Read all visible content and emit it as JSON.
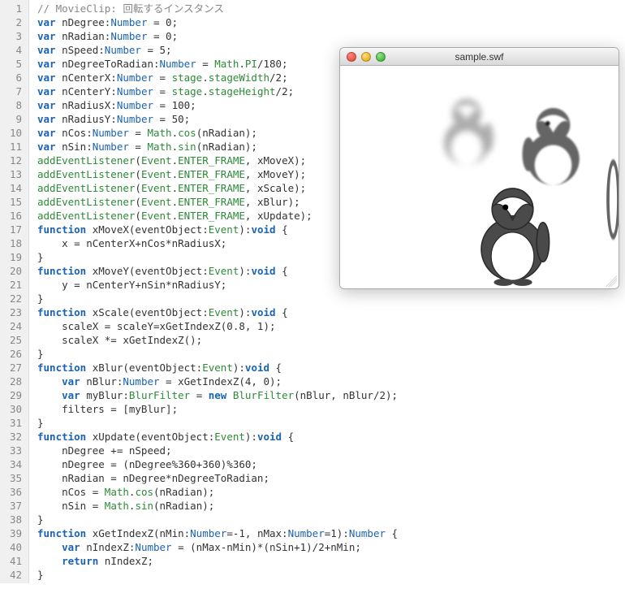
{
  "swf": {
    "title": "sample.swf"
  },
  "code": {
    "lines": [
      {
        "n": 1,
        "tokens": [
          [
            "cmt",
            "// MovieClip: 回転するインスタンス"
          ]
        ]
      },
      {
        "n": 2,
        "tokens": [
          [
            "kw",
            "var"
          ],
          [
            "txt",
            " nDegree:"
          ],
          [
            "type",
            "Number"
          ],
          [
            "txt",
            " = 0;"
          ]
        ]
      },
      {
        "n": 3,
        "tokens": [
          [
            "kw",
            "var"
          ],
          [
            "txt",
            " nRadian:"
          ],
          [
            "type",
            "Number"
          ],
          [
            "txt",
            " = 0;"
          ]
        ]
      },
      {
        "n": 4,
        "tokens": [
          [
            "kw",
            "var"
          ],
          [
            "txt",
            " nSpeed:"
          ],
          [
            "type",
            "Number"
          ],
          [
            "txt",
            " = 5;"
          ]
        ]
      },
      {
        "n": 5,
        "tokens": [
          [
            "kw",
            "var"
          ],
          [
            "txt",
            " nDegreeToRadian:"
          ],
          [
            "type",
            "Number"
          ],
          [
            "txt",
            " = "
          ],
          [
            "cls",
            "Math"
          ],
          [
            "txt",
            "."
          ],
          [
            "prop",
            "PI"
          ],
          [
            "txt",
            "/180;"
          ]
        ]
      },
      {
        "n": 6,
        "tokens": [
          [
            "kw",
            "var"
          ],
          [
            "txt",
            " nCenterX:"
          ],
          [
            "type",
            "Number"
          ],
          [
            "txt",
            " = "
          ],
          [
            "cls",
            "stage"
          ],
          [
            "txt",
            "."
          ],
          [
            "prop",
            "stageWidth"
          ],
          [
            "txt",
            "/2;"
          ]
        ]
      },
      {
        "n": 7,
        "tokens": [
          [
            "kw",
            "var"
          ],
          [
            "txt",
            " nCenterY:"
          ],
          [
            "type",
            "Number"
          ],
          [
            "txt",
            " = "
          ],
          [
            "cls",
            "stage"
          ],
          [
            "txt",
            "."
          ],
          [
            "prop",
            "stageHeight"
          ],
          [
            "txt",
            "/2;"
          ]
        ]
      },
      {
        "n": 8,
        "tokens": [
          [
            "kw",
            "var"
          ],
          [
            "txt",
            " nRadiusX:"
          ],
          [
            "type",
            "Number"
          ],
          [
            "txt",
            " = 100;"
          ]
        ]
      },
      {
        "n": 9,
        "tokens": [
          [
            "kw",
            "var"
          ],
          [
            "txt",
            " nRadiusY:"
          ],
          [
            "type",
            "Number"
          ],
          [
            "txt",
            " = 50;"
          ]
        ]
      },
      {
        "n": 10,
        "tokens": [
          [
            "kw",
            "var"
          ],
          [
            "txt",
            " nCos:"
          ],
          [
            "type",
            "Number"
          ],
          [
            "txt",
            " = "
          ],
          [
            "cls",
            "Math"
          ],
          [
            "txt",
            "."
          ],
          [
            "prop",
            "cos"
          ],
          [
            "txt",
            "(nRadian);"
          ]
        ]
      },
      {
        "n": 11,
        "tokens": [
          [
            "kw",
            "var"
          ],
          [
            "txt",
            " nSin:"
          ],
          [
            "type",
            "Number"
          ],
          [
            "txt",
            " = "
          ],
          [
            "cls",
            "Math"
          ],
          [
            "txt",
            "."
          ],
          [
            "prop",
            "sin"
          ],
          [
            "txt",
            "(nRadian);"
          ]
        ]
      },
      {
        "n": 12,
        "tokens": [
          [
            "call",
            "addEventListener"
          ],
          [
            "txt",
            "("
          ],
          [
            "cls",
            "Event"
          ],
          [
            "txt",
            "."
          ],
          [
            "prop",
            "ENTER_FRAME"
          ],
          [
            "txt",
            ", xMoveX);"
          ]
        ]
      },
      {
        "n": 13,
        "tokens": [
          [
            "call",
            "addEventListener"
          ],
          [
            "txt",
            "("
          ],
          [
            "cls",
            "Event"
          ],
          [
            "txt",
            "."
          ],
          [
            "prop",
            "ENTER_FRAME"
          ],
          [
            "txt",
            ", xMoveY);"
          ]
        ]
      },
      {
        "n": 14,
        "tokens": [
          [
            "call",
            "addEventListener"
          ],
          [
            "txt",
            "("
          ],
          [
            "cls",
            "Event"
          ],
          [
            "txt",
            "."
          ],
          [
            "prop",
            "ENTER_FRAME"
          ],
          [
            "txt",
            ", xScale);"
          ]
        ]
      },
      {
        "n": 15,
        "tokens": [
          [
            "call",
            "addEventListener"
          ],
          [
            "txt",
            "("
          ],
          [
            "cls",
            "Event"
          ],
          [
            "txt",
            "."
          ],
          [
            "prop",
            "ENTER_FRAME"
          ],
          [
            "txt",
            ", xBlur);"
          ]
        ]
      },
      {
        "n": 16,
        "tokens": [
          [
            "call",
            "addEventListener"
          ],
          [
            "txt",
            "("
          ],
          [
            "cls",
            "Event"
          ],
          [
            "txt",
            "."
          ],
          [
            "prop",
            "ENTER_FRAME"
          ],
          [
            "txt",
            ", xUpdate);"
          ]
        ]
      },
      {
        "n": 17,
        "tokens": [
          [
            "kw",
            "function"
          ],
          [
            "txt",
            " xMoveX(eventObject:"
          ],
          [
            "cls",
            "Event"
          ],
          [
            "txt",
            "):"
          ],
          [
            "kw",
            "void"
          ],
          [
            "txt",
            " {"
          ]
        ]
      },
      {
        "n": 18,
        "tokens": [
          [
            "txt",
            "    x = nCenterX+nCos*nRadiusX;"
          ]
        ]
      },
      {
        "n": 19,
        "tokens": [
          [
            "txt",
            "}"
          ]
        ]
      },
      {
        "n": 20,
        "tokens": [
          [
            "kw",
            "function"
          ],
          [
            "txt",
            " xMoveY(eventObject:"
          ],
          [
            "cls",
            "Event"
          ],
          [
            "txt",
            "):"
          ],
          [
            "kw",
            "void"
          ],
          [
            "txt",
            " {"
          ]
        ]
      },
      {
        "n": 21,
        "tokens": [
          [
            "txt",
            "    y = nCenterY+nSin*nRadiusY;"
          ]
        ]
      },
      {
        "n": 22,
        "tokens": [
          [
            "txt",
            "}"
          ]
        ]
      },
      {
        "n": 23,
        "tokens": [
          [
            "kw",
            "function"
          ],
          [
            "txt",
            " xScale(eventObject:"
          ],
          [
            "cls",
            "Event"
          ],
          [
            "txt",
            "):"
          ],
          [
            "kw",
            "void"
          ],
          [
            "txt",
            " {"
          ]
        ]
      },
      {
        "n": 24,
        "tokens": [
          [
            "txt",
            "    scaleX = scaleY=xGetIndexZ(0.8, 1);"
          ]
        ]
      },
      {
        "n": 25,
        "tokens": [
          [
            "txt",
            "    scaleX *= xGetIndexZ();"
          ]
        ]
      },
      {
        "n": 26,
        "tokens": [
          [
            "txt",
            "}"
          ]
        ]
      },
      {
        "n": 27,
        "tokens": [
          [
            "kw",
            "function"
          ],
          [
            "txt",
            " xBlur(eventObject:"
          ],
          [
            "cls",
            "Event"
          ],
          [
            "txt",
            "):"
          ],
          [
            "kw",
            "void"
          ],
          [
            "txt",
            " {"
          ]
        ]
      },
      {
        "n": 28,
        "tokens": [
          [
            "txt",
            "    "
          ],
          [
            "kw",
            "var"
          ],
          [
            "txt",
            " nBlur:"
          ],
          [
            "type",
            "Number"
          ],
          [
            "txt",
            " = xGetIndexZ(4, 0);"
          ]
        ]
      },
      {
        "n": 29,
        "tokens": [
          [
            "txt",
            "    "
          ],
          [
            "kw",
            "var"
          ],
          [
            "txt",
            " myBlur:"
          ],
          [
            "cls",
            "BlurFilter"
          ],
          [
            "txt",
            " = "
          ],
          [
            "kw",
            "new"
          ],
          [
            "txt",
            " "
          ],
          [
            "cls",
            "BlurFilter"
          ],
          [
            "txt",
            "(nBlur, nBlur/2);"
          ]
        ]
      },
      {
        "n": 30,
        "tokens": [
          [
            "txt",
            "    filters = [myBlur];"
          ]
        ]
      },
      {
        "n": 31,
        "tokens": [
          [
            "txt",
            "}"
          ]
        ]
      },
      {
        "n": 32,
        "tokens": [
          [
            "kw",
            "function"
          ],
          [
            "txt",
            " xUpdate(eventObject:"
          ],
          [
            "cls",
            "Event"
          ],
          [
            "txt",
            "):"
          ],
          [
            "kw",
            "void"
          ],
          [
            "txt",
            " {"
          ]
        ]
      },
      {
        "n": 33,
        "tokens": [
          [
            "txt",
            "    nDegree += nSpeed;"
          ]
        ]
      },
      {
        "n": 34,
        "tokens": [
          [
            "txt",
            "    nDegree = (nDegree%360+360)%360;"
          ]
        ]
      },
      {
        "n": 35,
        "tokens": [
          [
            "txt",
            "    nRadian = nDegree*nDegreeToRadian;"
          ]
        ]
      },
      {
        "n": 36,
        "tokens": [
          [
            "txt",
            "    nCos = "
          ],
          [
            "cls",
            "Math"
          ],
          [
            "txt",
            "."
          ],
          [
            "prop",
            "cos"
          ],
          [
            "txt",
            "(nRadian);"
          ]
        ]
      },
      {
        "n": 37,
        "tokens": [
          [
            "txt",
            "    nSin = "
          ],
          [
            "cls",
            "Math"
          ],
          [
            "txt",
            "."
          ],
          [
            "prop",
            "sin"
          ],
          [
            "txt",
            "(nRadian);"
          ]
        ]
      },
      {
        "n": 38,
        "tokens": [
          [
            "txt",
            "}"
          ]
        ]
      },
      {
        "n": 39,
        "tokens": [
          [
            "kw",
            "function"
          ],
          [
            "txt",
            " xGetIndexZ(nMin:"
          ],
          [
            "type",
            "Number"
          ],
          [
            "txt",
            "=-1, nMax:"
          ],
          [
            "type",
            "Number"
          ],
          [
            "txt",
            "=1):"
          ],
          [
            "type",
            "Number"
          ],
          [
            "txt",
            " {"
          ]
        ]
      },
      {
        "n": 40,
        "tokens": [
          [
            "txt",
            "    "
          ],
          [
            "kw",
            "var"
          ],
          [
            "txt",
            " nIndexZ:"
          ],
          [
            "type",
            "Number"
          ],
          [
            "txt",
            " = (nMax-nMin)*(nSin+1)/2+nMin;"
          ]
        ]
      },
      {
        "n": 41,
        "tokens": [
          [
            "txt",
            "    "
          ],
          [
            "kw",
            "return"
          ],
          [
            "txt",
            " nIndexZ;"
          ]
        ]
      },
      {
        "n": 42,
        "tokens": [
          [
            "txt",
            "}"
          ]
        ]
      }
    ]
  }
}
